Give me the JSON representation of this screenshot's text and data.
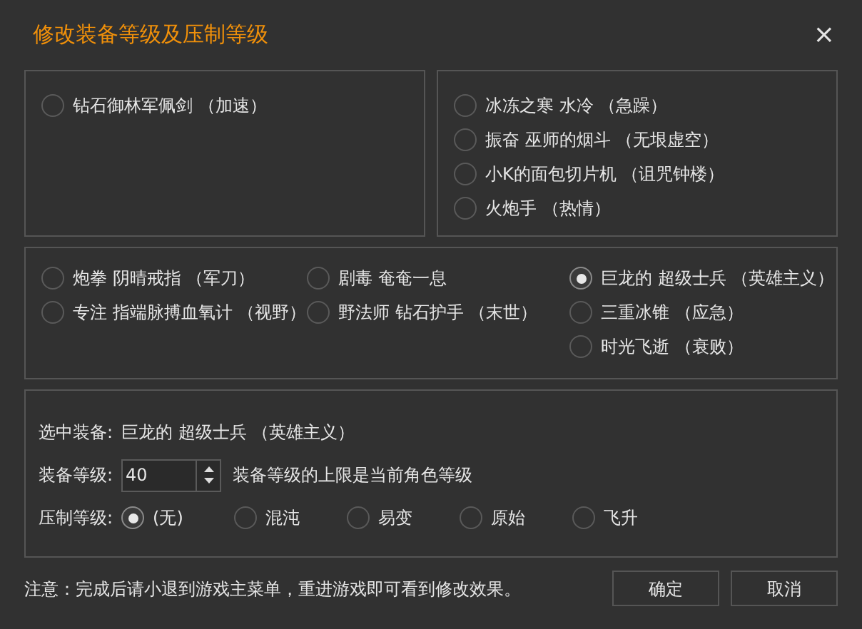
{
  "window": {
    "title": "修改装备等级及压制等级",
    "close": "×"
  },
  "equipment_left": [
    {
      "label": "钻石御林军佩剑 （加速）",
      "selected": false
    }
  ],
  "equipment_right": [
    {
      "label": "冰冻之寒 水冷 （急躁）",
      "selected": false
    },
    {
      "label": "振奋 巫师的烟斗 （无垠虚空）",
      "selected": false
    },
    {
      "label": "小K的面包切片机 （诅咒钟楼）",
      "selected": false
    },
    {
      "label": "火炮手 （热情）",
      "selected": false
    }
  ],
  "equipment_middle": [
    [
      {
        "label": "炮拳 阴晴戒指 （军刀）",
        "selected": false
      },
      {
        "label": "专注 指端脉搏血氧计 （视野）",
        "selected": false
      }
    ],
    [
      {
        "label": "剧毒 奄奄一息",
        "selected": false
      },
      {
        "label": "野法师 钻石护手 （末世）",
        "selected": false
      }
    ],
    [
      {
        "label": "巨龙的 超级士兵 （英雄主义）",
        "selected": true
      },
      {
        "label": "三重冰锥 （应急）",
        "selected": false
      },
      {
        "label": "时光飞逝 （衰败）",
        "selected": false
      }
    ]
  ],
  "details": {
    "selected_label": "选中装备:",
    "selected_value": "巨龙的 超级士兵 （英雄主义）",
    "level_label": "装备等级:",
    "level_value": "40",
    "level_hint": "装备等级的上限是当前角色等级",
    "suppress_label": "压制等级:",
    "suppress_options": [
      {
        "label": "(无)",
        "selected": true
      },
      {
        "label": "混沌",
        "selected": false
      },
      {
        "label": "易变",
        "selected": false
      },
      {
        "label": "原始",
        "selected": false
      },
      {
        "label": "飞升",
        "selected": false
      }
    ]
  },
  "footer": {
    "note": "注意：完成后请小退到游戏主菜单，重进游戏即可看到修改效果。",
    "buttons": [
      "确定",
      "取消"
    ]
  }
}
